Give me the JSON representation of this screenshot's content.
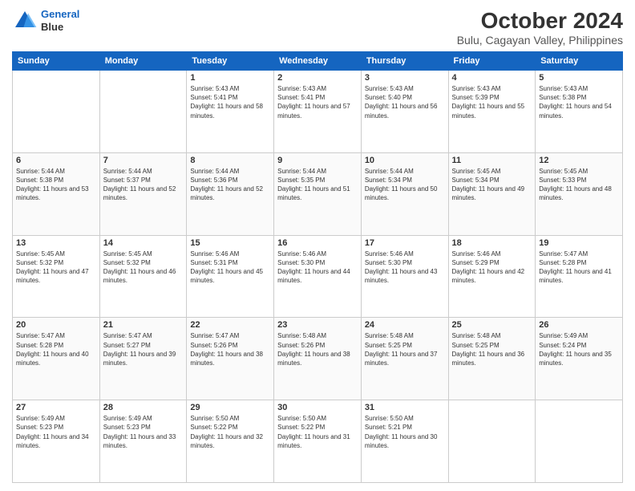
{
  "header": {
    "logo": {
      "line1": "General",
      "line2": "Blue"
    },
    "title": "October 2024",
    "subtitle": "Bulu, Cagayan Valley, Philippines"
  },
  "days_of_week": [
    "Sunday",
    "Monday",
    "Tuesday",
    "Wednesday",
    "Thursday",
    "Friday",
    "Saturday"
  ],
  "weeks": [
    [
      {
        "day": "",
        "sunrise": "",
        "sunset": "",
        "daylight": ""
      },
      {
        "day": "",
        "sunrise": "",
        "sunset": "",
        "daylight": ""
      },
      {
        "day": "1",
        "sunrise": "Sunrise: 5:43 AM",
        "sunset": "Sunset: 5:41 PM",
        "daylight": "Daylight: 11 hours and 58 minutes."
      },
      {
        "day": "2",
        "sunrise": "Sunrise: 5:43 AM",
        "sunset": "Sunset: 5:41 PM",
        "daylight": "Daylight: 11 hours and 57 minutes."
      },
      {
        "day": "3",
        "sunrise": "Sunrise: 5:43 AM",
        "sunset": "Sunset: 5:40 PM",
        "daylight": "Daylight: 11 hours and 56 minutes."
      },
      {
        "day": "4",
        "sunrise": "Sunrise: 5:43 AM",
        "sunset": "Sunset: 5:39 PM",
        "daylight": "Daylight: 11 hours and 55 minutes."
      },
      {
        "day": "5",
        "sunrise": "Sunrise: 5:43 AM",
        "sunset": "Sunset: 5:38 PM",
        "daylight": "Daylight: 11 hours and 54 minutes."
      }
    ],
    [
      {
        "day": "6",
        "sunrise": "Sunrise: 5:44 AM",
        "sunset": "Sunset: 5:38 PM",
        "daylight": "Daylight: 11 hours and 53 minutes."
      },
      {
        "day": "7",
        "sunrise": "Sunrise: 5:44 AM",
        "sunset": "Sunset: 5:37 PM",
        "daylight": "Daylight: 11 hours and 52 minutes."
      },
      {
        "day": "8",
        "sunrise": "Sunrise: 5:44 AM",
        "sunset": "Sunset: 5:36 PM",
        "daylight": "Daylight: 11 hours and 52 minutes."
      },
      {
        "day": "9",
        "sunrise": "Sunrise: 5:44 AM",
        "sunset": "Sunset: 5:35 PM",
        "daylight": "Daylight: 11 hours and 51 minutes."
      },
      {
        "day": "10",
        "sunrise": "Sunrise: 5:44 AM",
        "sunset": "Sunset: 5:34 PM",
        "daylight": "Daylight: 11 hours and 50 minutes."
      },
      {
        "day": "11",
        "sunrise": "Sunrise: 5:45 AM",
        "sunset": "Sunset: 5:34 PM",
        "daylight": "Daylight: 11 hours and 49 minutes."
      },
      {
        "day": "12",
        "sunrise": "Sunrise: 5:45 AM",
        "sunset": "Sunset: 5:33 PM",
        "daylight": "Daylight: 11 hours and 48 minutes."
      }
    ],
    [
      {
        "day": "13",
        "sunrise": "Sunrise: 5:45 AM",
        "sunset": "Sunset: 5:32 PM",
        "daylight": "Daylight: 11 hours and 47 minutes."
      },
      {
        "day": "14",
        "sunrise": "Sunrise: 5:45 AM",
        "sunset": "Sunset: 5:32 PM",
        "daylight": "Daylight: 11 hours and 46 minutes."
      },
      {
        "day": "15",
        "sunrise": "Sunrise: 5:46 AM",
        "sunset": "Sunset: 5:31 PM",
        "daylight": "Daylight: 11 hours and 45 minutes."
      },
      {
        "day": "16",
        "sunrise": "Sunrise: 5:46 AM",
        "sunset": "Sunset: 5:30 PM",
        "daylight": "Daylight: 11 hours and 44 minutes."
      },
      {
        "day": "17",
        "sunrise": "Sunrise: 5:46 AM",
        "sunset": "Sunset: 5:30 PM",
        "daylight": "Daylight: 11 hours and 43 minutes."
      },
      {
        "day": "18",
        "sunrise": "Sunrise: 5:46 AM",
        "sunset": "Sunset: 5:29 PM",
        "daylight": "Daylight: 11 hours and 42 minutes."
      },
      {
        "day": "19",
        "sunrise": "Sunrise: 5:47 AM",
        "sunset": "Sunset: 5:28 PM",
        "daylight": "Daylight: 11 hours and 41 minutes."
      }
    ],
    [
      {
        "day": "20",
        "sunrise": "Sunrise: 5:47 AM",
        "sunset": "Sunset: 5:28 PM",
        "daylight": "Daylight: 11 hours and 40 minutes."
      },
      {
        "day": "21",
        "sunrise": "Sunrise: 5:47 AM",
        "sunset": "Sunset: 5:27 PM",
        "daylight": "Daylight: 11 hours and 39 minutes."
      },
      {
        "day": "22",
        "sunrise": "Sunrise: 5:47 AM",
        "sunset": "Sunset: 5:26 PM",
        "daylight": "Daylight: 11 hours and 38 minutes."
      },
      {
        "day": "23",
        "sunrise": "Sunrise: 5:48 AM",
        "sunset": "Sunset: 5:26 PM",
        "daylight": "Daylight: 11 hours and 38 minutes."
      },
      {
        "day": "24",
        "sunrise": "Sunrise: 5:48 AM",
        "sunset": "Sunset: 5:25 PM",
        "daylight": "Daylight: 11 hours and 37 minutes."
      },
      {
        "day": "25",
        "sunrise": "Sunrise: 5:48 AM",
        "sunset": "Sunset: 5:25 PM",
        "daylight": "Daylight: 11 hours and 36 minutes."
      },
      {
        "day": "26",
        "sunrise": "Sunrise: 5:49 AM",
        "sunset": "Sunset: 5:24 PM",
        "daylight": "Daylight: 11 hours and 35 minutes."
      }
    ],
    [
      {
        "day": "27",
        "sunrise": "Sunrise: 5:49 AM",
        "sunset": "Sunset: 5:23 PM",
        "daylight": "Daylight: 11 hours and 34 minutes."
      },
      {
        "day": "28",
        "sunrise": "Sunrise: 5:49 AM",
        "sunset": "Sunset: 5:23 PM",
        "daylight": "Daylight: 11 hours and 33 minutes."
      },
      {
        "day": "29",
        "sunrise": "Sunrise: 5:50 AM",
        "sunset": "Sunset: 5:22 PM",
        "daylight": "Daylight: 11 hours and 32 minutes."
      },
      {
        "day": "30",
        "sunrise": "Sunrise: 5:50 AM",
        "sunset": "Sunset: 5:22 PM",
        "daylight": "Daylight: 11 hours and 31 minutes."
      },
      {
        "day": "31",
        "sunrise": "Sunrise: 5:50 AM",
        "sunset": "Sunset: 5:21 PM",
        "daylight": "Daylight: 11 hours and 30 minutes."
      },
      {
        "day": "",
        "sunrise": "",
        "sunset": "",
        "daylight": ""
      },
      {
        "day": "",
        "sunrise": "",
        "sunset": "",
        "daylight": ""
      }
    ]
  ]
}
